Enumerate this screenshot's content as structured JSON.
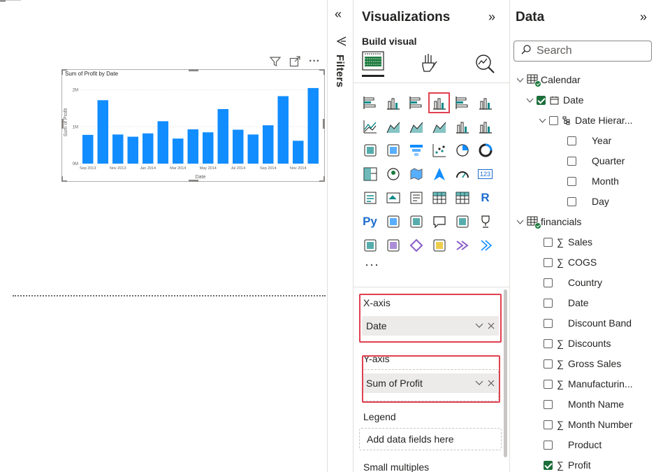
{
  "canvas": {
    "visual_title": "Sum of Profit by Date",
    "header_icons": [
      "filter-icon",
      "focus-mode-icon",
      "more-options-icon"
    ],
    "more_label": "···"
  },
  "chart_data": {
    "type": "bar",
    "title": "Sum of Profit by Date",
    "xlabel": "Date",
    "ylabel": "Sum of Profit",
    "ylim": [
      0,
      2200000
    ],
    "yticks": [
      {
        "value": 0,
        "label": "0M"
      },
      {
        "value": 1000000,
        "label": "1M"
      },
      {
        "value": 2000000,
        "label": "2M"
      }
    ],
    "x_tick_labels": [
      "Sep 2013",
      "Nov 2013",
      "Jan 2014",
      "Mar 2014",
      "May 2014",
      "Jul 2014",
      "Sep 2014",
      "Nov 2014"
    ],
    "values": [
      780000,
      1720000,
      790000,
      730000,
      820000,
      1150000,
      680000,
      930000,
      850000,
      1480000,
      920000,
      790000,
      1040000,
      1830000,
      620000,
      2050000
    ],
    "grid": true,
    "color": "#118dff"
  },
  "filters": {
    "collapse_glyph": "«",
    "label": "Filters"
  },
  "visualizations": {
    "title": "Visualizations",
    "expand_glyph": "»",
    "build_visual": "Build visual",
    "more": "···",
    "icons": [
      [
        "stacked-bar-chart-icon",
        "stacked-column-chart-icon",
        "clustered-bar-chart-icon",
        "clustered-column-chart-icon",
        "100-stacked-bar-chart-icon",
        "100-stacked-column-chart-icon"
      ],
      [
        "line-chart-icon",
        "area-chart-icon",
        "stacked-area-chart-icon",
        "100-stacked-area-chart-icon",
        "line-and-stacked-column-chart-icon",
        "line-and-clustered-column-chart-icon"
      ],
      [
        "ribbon-chart-icon",
        "waterfall-chart-icon",
        "funnel-chart-icon",
        "scatter-chart-icon",
        "pie-chart-icon",
        "donut-chart-icon"
      ],
      [
        "treemap-icon",
        "map-icon",
        "filled-map-icon",
        "azure-map-icon",
        "gauge-icon",
        "card-icon"
      ],
      [
        "multi-row-card-icon",
        "kpi-icon",
        "slicer-icon",
        "table-icon",
        "matrix-icon",
        "r-script-visual-icon"
      ],
      [
        "python-visual-icon",
        "key-influencers-icon",
        "decomposition-tree-icon",
        "qa-icon",
        "smart-narrative-icon",
        "metrics-icon"
      ],
      [
        "paginated-report-icon",
        "power-apps-icon",
        "power-automate-icon",
        "arcgis-map-icon",
        "power-automate-flow-icon",
        "get-more-visuals-icon"
      ]
    ],
    "r_label": "R",
    "py_label": "Py",
    "card_label": "123",
    "selected_index": [
      0,
      3
    ],
    "wells": {
      "x_axis_label": "X-axis",
      "x_axis_field": "Date",
      "y_axis_label": "Y-axis",
      "y_axis_field": "Sum of Profit",
      "legend_label": "Legend",
      "legend_placeholder": "Add data fields here",
      "small_multiples_label": "Small multiples"
    }
  },
  "data": {
    "title": "Data",
    "expand_glyph": "»",
    "search_placeholder": "Search",
    "tree": [
      {
        "level": 0,
        "chevron": true,
        "table": true,
        "label": "Calendar"
      },
      {
        "level": 1,
        "chevron": true,
        "checkbox": "checked",
        "calendar_icon": true,
        "label": "Date"
      },
      {
        "level": 2,
        "chevron": true,
        "checkbox": "empty",
        "hierarchy_icon": true,
        "label": "Date Hierar..."
      },
      {
        "level": 3,
        "checkbox": "empty",
        "label": "Year"
      },
      {
        "level": 3,
        "checkbox": "empty",
        "label": "Quarter"
      },
      {
        "level": 3,
        "checkbox": "empty",
        "label": "Month"
      },
      {
        "level": 3,
        "checkbox": "empty",
        "label": "Day"
      },
      {
        "level": 0,
        "chevron": true,
        "table": true,
        "label": "financials"
      },
      {
        "level": 1,
        "checkbox": "empty",
        "sigma": true,
        "label": "Sales"
      },
      {
        "level": 1,
        "checkbox": "empty",
        "sigma": true,
        "label": "COGS"
      },
      {
        "level": 1,
        "checkbox": "empty",
        "label": "Country"
      },
      {
        "level": 1,
        "checkbox": "empty",
        "label": "Date"
      },
      {
        "level": 1,
        "checkbox": "empty",
        "label": "Discount Band"
      },
      {
        "level": 1,
        "checkbox": "empty",
        "sigma": true,
        "label": "Discounts"
      },
      {
        "level": 1,
        "checkbox": "empty",
        "sigma": true,
        "label": "Gross Sales"
      },
      {
        "level": 1,
        "checkbox": "empty",
        "sigma": true,
        "label": "Manufacturin..."
      },
      {
        "level": 1,
        "checkbox": "empty",
        "label": "Month Name"
      },
      {
        "level": 1,
        "checkbox": "empty",
        "sigma": true,
        "label": "Month Number"
      },
      {
        "level": 1,
        "checkbox": "empty",
        "label": "Product"
      },
      {
        "level": 1,
        "checkbox": "checked",
        "sigma": true,
        "label": "Profit"
      }
    ],
    "sigma_glyph": "∑"
  },
  "colors": {
    "accent": "#118dff",
    "highlight_red": "#e04050",
    "checked_green": "#1b6e3a",
    "text": "#252423"
  }
}
